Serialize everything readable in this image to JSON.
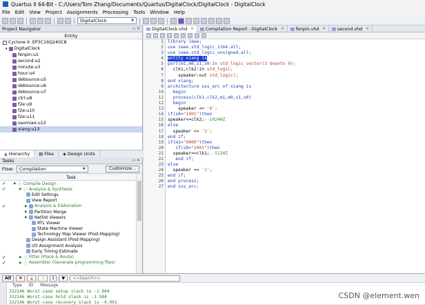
{
  "window": {
    "title": "Quartus II 64-Bit - C:/Users/Tom Zhang/Documents/Quartus/DigitalClock/DigitalClock - DigitalClock"
  },
  "menu": [
    "File",
    "Edit",
    "View",
    "Project",
    "Assignments",
    "Processing",
    "Tools",
    "Window",
    "Help"
  ],
  "toolbar": {
    "entity_combo": "DigitalClock"
  },
  "navigator": {
    "title": "Project Navigator",
    "column": "Entity",
    "device": "Cyclone II: EP3C16Q240C8",
    "top": "DigitalClock",
    "items": [
      "fenpin:u1",
      "second:u2",
      "minute:u3",
      "hour:u4",
      "debounce:u5",
      "debounce:u6",
      "debounce:u7",
      "ctrl:u8",
      "f2e:u9",
      "f2e:u10",
      "f2e:u11",
      "saomiao:u12",
      "xiang:u13"
    ],
    "tabs": [
      "Hierarchy",
      "Files",
      "Design Units"
    ]
  },
  "tasks": {
    "title": "Tasks",
    "flow_label": "Flow:",
    "flow_value": "Compilation",
    "customize": "Customize...",
    "column": "Task",
    "rows": [
      {
        "label": "Compile Design",
        "indent": 1,
        "check": true,
        "green": true
      },
      {
        "label": "Analysis & Synthesis",
        "indent": 2,
        "check": true,
        "green": true
      },
      {
        "label": "Edit Settings",
        "indent": 3,
        "check": false,
        "green": false
      },
      {
        "label": "View Report",
        "indent": 3,
        "check": false,
        "green": false
      },
      {
        "label": "Analysis & Elaboration",
        "indent": 3,
        "check": true,
        "green": true
      },
      {
        "label": "Partition Merge",
        "indent": 3,
        "check": false,
        "green": false
      },
      {
        "label": "Netlist Viewers",
        "indent": 3,
        "check": false,
        "green": false
      },
      {
        "label": "RTL Viewer",
        "indent": 4,
        "check": false,
        "green": false
      },
      {
        "label": "State Machine Viewer",
        "indent": 4,
        "check": false,
        "green": false
      },
      {
        "label": "Technology Map Viewer (Post-Mapping)",
        "indent": 4,
        "check": false,
        "green": false
      },
      {
        "label": "Design Assistant (Post-Mapping)",
        "indent": 3,
        "check": false,
        "green": false
      },
      {
        "label": "I/O Assignment Analysis",
        "indent": 3,
        "check": false,
        "green": false
      },
      {
        "label": "Early Timing Estimate",
        "indent": 3,
        "check": false,
        "green": false
      },
      {
        "label": "Fitter (Place & Route)",
        "indent": 2,
        "check": true,
        "green": true
      },
      {
        "label": "Assembler (Generate programming files)",
        "indent": 2,
        "check": true,
        "green": true
      }
    ]
  },
  "editor": {
    "tabs": [
      "DigitalClock.vhd",
      "Compilation Report - DigitalClock",
      "fenpin.vhd",
      "second.vhd"
    ],
    "lines": [
      [
        {
          "t": "library ieee;",
          "c": "kw"
        }
      ],
      [
        {
          "t": "use ieee.std_logic_1164.all;",
          "c": "kw"
        }
      ],
      [
        {
          "t": "use ieee.std_logic_unsigned.all;",
          "c": "kw"
        }
      ],
      [
        {
          "t": "entity xiang is",
          "c": "hl"
        }
      ],
      [
        {
          "t": "port(m1,m0,s1,s0:in ",
          "c": "kw"
        },
        {
          "t": "std_logic_vector(3 downto 0);",
          "c": "str"
        }
      ],
      [
        {
          "t": "  clk1,clk2:in ",
          "c": ""
        },
        {
          "t": "std_logic;",
          "c": "str"
        }
      ],
      [
        {
          "t": "    speaker:out ",
          "c": ""
        },
        {
          "t": "std_logic);",
          "c": "str"
        }
      ],
      [
        {
          "t": "end xiang;",
          "c": "kw"
        }
      ],
      [
        {
          "t": "architecture sss_arc of xiang is",
          "c": "kw"
        }
      ],
      [
        {
          "t": "  begin",
          "c": "kw"
        }
      ],
      [
        {
          "t": "  process(clk1,clk2,m1,m0,s1,s0)",
          "c": "kw"
        }
      ],
      [
        {
          "t": "  begin",
          "c": "kw"
        }
      ],
      [
        {
          "t": "    speaker <= ",
          "c": ""
        },
        {
          "t": "'0';",
          "c": "str"
        }
      ],
      [
        {
          "t": "if(s0=",
          "c": "kw"
        },
        {
          "t": "\"1001\"",
          "c": "str"
        },
        {
          "t": ")then",
          "c": "kw"
        }
      ],
      [
        {
          "t": "speaker<=clk2;",
          "c": ""
        },
        {
          "t": "--1024HZ",
          "c": "cm"
        }
      ],
      [
        {
          "t": "else",
          "c": "kw"
        }
      ],
      [
        {
          "t": "  speaker <= ",
          "c": ""
        },
        {
          "t": "'1';",
          "c": "str"
        }
      ],
      [
        {
          "t": "end if;",
          "c": "kw"
        }
      ],
      [
        {
          "t": "if(m1=",
          "c": "kw"
        },
        {
          "t": "\"0000\"",
          "c": "str"
        },
        {
          "t": ")then",
          "c": "kw"
        }
      ],
      [
        {
          "t": "   if(s0=",
          "c": "kw"
        },
        {
          "t": "\"1001\"",
          "c": "str"
        },
        {
          "t": ")then",
          "c": "kw"
        }
      ],
      [
        {
          "t": "  speaker<=clk1;",
          "c": ""
        },
        {
          "t": "--512HZ",
          "c": "cm"
        }
      ],
      [
        {
          "t": "   end if;",
          "c": "kw"
        }
      ],
      [
        {
          "t": "else",
          "c": "kw"
        }
      ],
      [
        {
          "t": "  speaker <= ",
          "c": ""
        },
        {
          "t": "'1';",
          "c": "str"
        }
      ],
      [
        {
          "t": "end if;",
          "c": "kw"
        }
      ],
      [
        {
          "t": "end process;",
          "c": "kw"
        }
      ],
      [
        {
          "t": "end sss_arc;",
          "c": "kw"
        }
      ]
    ]
  },
  "messages": {
    "all_label": "All",
    "search_placeholder": "<<Search>>",
    "columns": [
      "Type",
      "ID",
      "Message"
    ],
    "rows": [
      {
        "id": "332146",
        "text": "Worst-case setup slack is -1.944"
      },
      {
        "id": "332146",
        "text": "Worst-case hold slack is -1.584"
      },
      {
        "id": "332146",
        "text": "Worst-case recovery slack is -0.091"
      }
    ]
  },
  "watermark": "CSDN @element.wen",
  "colors": {
    "keyword": "#1c3fb4",
    "string": "#b33b2b",
    "comment": "#2a8a2a",
    "highlight": "#1d3ed4"
  }
}
